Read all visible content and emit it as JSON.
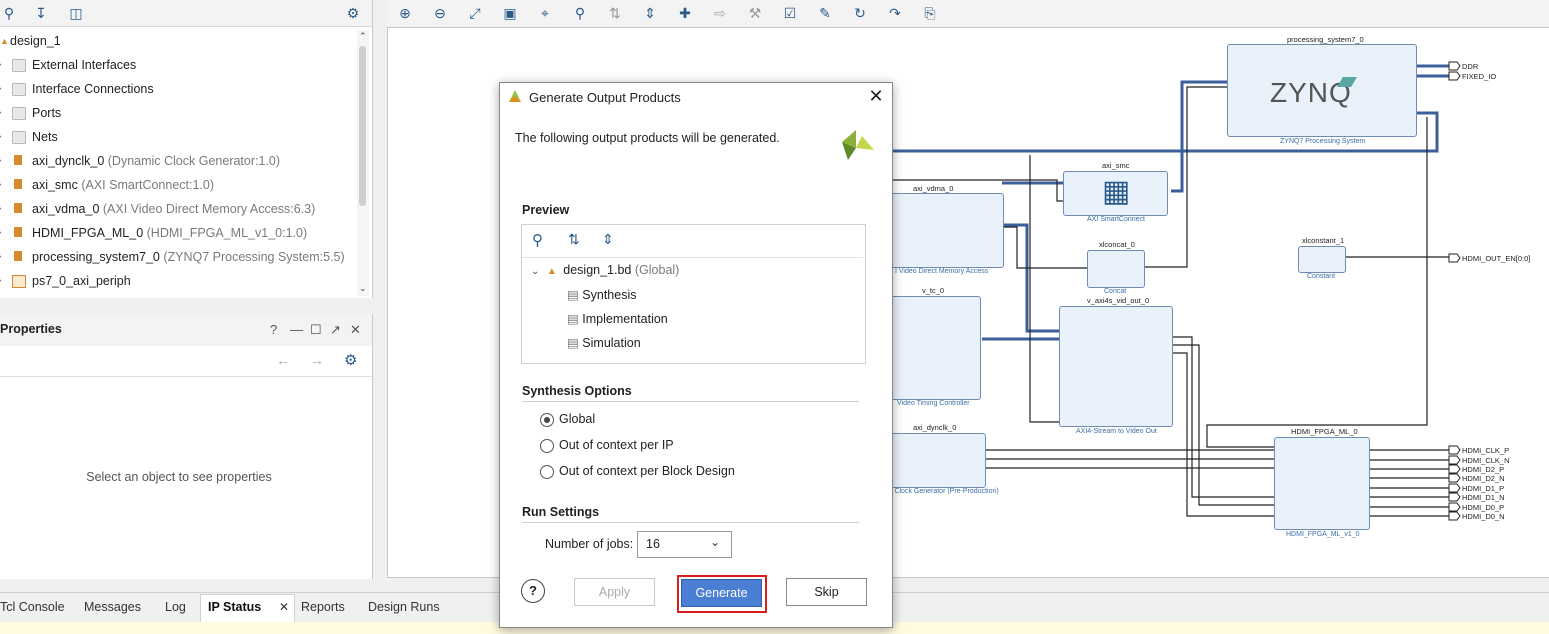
{
  "sources": {
    "root": "design_1",
    "items": [
      {
        "label": "External Interfaces",
        "sub": ""
      },
      {
        "label": "Interface Connections",
        "sub": ""
      },
      {
        "label": "Ports",
        "sub": ""
      },
      {
        "label": "Nets",
        "sub": ""
      },
      {
        "label": "axi_dynclk_0",
        "sub": "(Dynamic Clock Generator:1.0)"
      },
      {
        "label": "axi_smc",
        "sub": "(AXI SmartConnect:1.0)"
      },
      {
        "label": "axi_vdma_0",
        "sub": "(AXI Video Direct Memory Access:6.3)"
      },
      {
        "label": "HDMI_FPGA_ML_0",
        "sub": "(HDMI_FPGA_ML_v1_0:1.0)"
      },
      {
        "label": "processing_system7_0",
        "sub": "(ZYNQ7 Processing System:5.5)"
      },
      {
        "label": "ps7_0_axi_periph",
        "sub": ""
      }
    ]
  },
  "properties": {
    "title": "Properties",
    "help": "?",
    "empty_text": "Select an object to see properties"
  },
  "diagram": {
    "zynq": {
      "title": "processing_system7_0",
      "logo": "ZYNQ",
      "sub": "ZYNQ7 Processing System",
      "ports": [
        "DDR",
        "FIXED_IO"
      ]
    },
    "axi_smc": {
      "title": "axi_smc",
      "sub": "AXI SmartConnect"
    },
    "axi_vdma": {
      "title": "axi_vdma_0",
      "sub": "I Video Direct Memory Access"
    },
    "xlconcat": {
      "title": "xlconcat_0",
      "sub": "Concat"
    },
    "xlconstant": {
      "title": "xlconstant_1",
      "sub": "Constant",
      "port": "HDMI_OUT_EN[0:0]"
    },
    "v_tc": {
      "title": "v_tc_0",
      "sub": "Video Timing Controller"
    },
    "v_axi4s": {
      "title": "v_axi4s_vid_out_0",
      "sub": "AXI4-Stream to Video Out"
    },
    "axi_dynclk": {
      "title": "axi_dynclk_0",
      "sub": "c Clock Generator (Pre-Production)"
    },
    "hdmi": {
      "title": "HDMI_FPGA_ML_0",
      "sub": "HDMI_FPGA_ML_v1_0",
      "ports": [
        "HDMI_CLK_P",
        "HDMI_CLK_N",
        "HDMI_D2_P",
        "HDMI_D2_N",
        "HDMI_D1_P",
        "HDMI_D1_N",
        "HDMI_D0_P",
        "HDMI_D0_N"
      ]
    }
  },
  "bottom_tabs": [
    "Tcl Console",
    "Messages",
    "Log",
    "IP Status",
    "Reports",
    "Design Runs"
  ],
  "dialog": {
    "title": "Generate Output Products",
    "message": "The following output products will be generated.",
    "preview_heading": "Preview",
    "tree_root": "design_1.bd",
    "tree_root_sub": "(Global)",
    "tree_children": [
      "Synthesis",
      "Implementation",
      "Simulation"
    ],
    "synth_heading": "Synthesis Options",
    "synth_options": [
      "Global",
      "Out of context per IP",
      "Out of context per Block Design"
    ],
    "synth_selected": "Global",
    "run_heading": "Run Settings",
    "jobs_label": "Number of jobs:",
    "jobs_value": "16",
    "buttons": {
      "help": "?",
      "apply": "Apply",
      "generate": "Generate",
      "skip": "Skip"
    }
  },
  "colors": {
    "accent": "#4a7fd3",
    "block_fill": "#e9f1fb",
    "block_border": "#6f8db3",
    "bus": "#3b5f9a",
    "highlight": "#d62020"
  }
}
